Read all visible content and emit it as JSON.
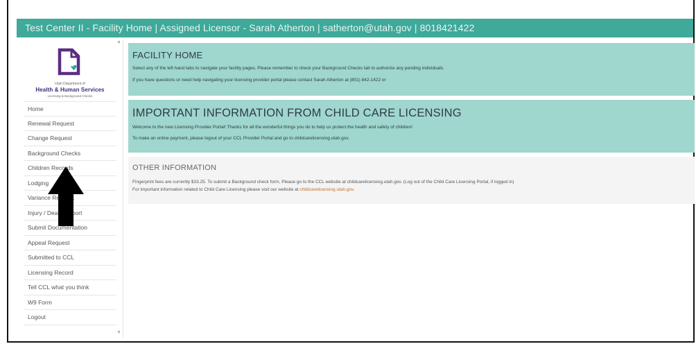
{
  "header": {
    "title": "Test Center II - Facility Home | Assigned Licensor - Sarah Atherton | satherton@utah.gov | 8018421422"
  },
  "logo": {
    "line1": "Utah Department of",
    "line2": "Health & Human Services",
    "line3": "Licensing & Background Checks"
  },
  "sidebar": {
    "items": [
      {
        "label": "Home"
      },
      {
        "label": "Renewal Request"
      },
      {
        "label": "Change Request"
      },
      {
        "label": "Background Checks"
      },
      {
        "label": "Children Records"
      },
      {
        "label": "Lodging"
      },
      {
        "label": "Variance Request"
      },
      {
        "label": "Injury / Death Report"
      },
      {
        "label": "Submit Documentation"
      },
      {
        "label": "Appeal Request"
      },
      {
        "label": "Submitted to CCL"
      },
      {
        "label": "Licensing Record"
      },
      {
        "label": "Tell CCL what you think"
      },
      {
        "label": "W9 Form"
      },
      {
        "label": "Logout"
      }
    ]
  },
  "facility": {
    "title": "FACILITY HOME",
    "line1": "Select any of the left hand tabs to navigate your facility pages. Please remember to check your Background Checks tab to authorize any pending individuals.",
    "line2": "If you have questions or need help navigating your licensing provider portal please contact Sarah Atherton at (801) 842-1422 or"
  },
  "important": {
    "title": "IMPORTANT INFORMATION FROM CHILD CARE LICENSING",
    "line1": "Welcome to the new Licensing Provider Portal! Thanks for all the wonderful things you do to help us protect the health and safety of children!",
    "line2": "To make an online payment, please logout of your CCL Provider Portal and go to childcarelicensing.utah.gov."
  },
  "other": {
    "title": "OTHER INFORMATION",
    "line1": "Fingerprint fees are currently $33.25. To submit a Background check form, Please go to the CCL website at childcarelicensing.utah.gov. (Log out of the Child Care Licensing Portal, if logged in)",
    "line2_prefix": "For important information related to Child Care Licensing please visit our website at",
    "line2_link": "childcarelicensing.utah.gov."
  },
  "colors": {
    "header_bg": "#3fa99a",
    "panel_bg": "#9fd6cd",
    "other_bg": "#f4f4f4",
    "logo_purple": "#5b2d82",
    "link": "#c0712d"
  }
}
